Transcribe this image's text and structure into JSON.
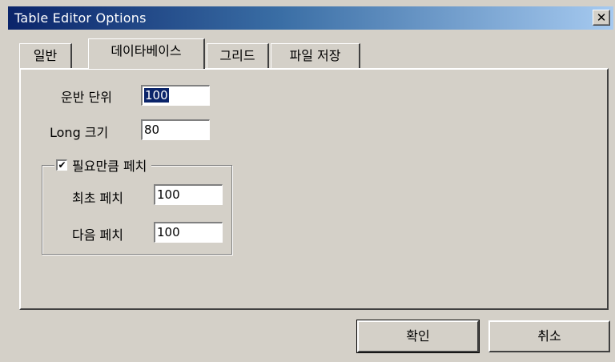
{
  "window": {
    "title": "Table Editor Options",
    "close_glyph": "✕"
  },
  "tabs": [
    {
      "label": "일반",
      "active": false
    },
    {
      "label": "데이타베이스",
      "active": true
    },
    {
      "label": "그리드",
      "active": false
    },
    {
      "label": "파일 저장",
      "active": false
    }
  ],
  "fields": {
    "transfer_unit": {
      "label": "운반 단위",
      "value": "100"
    },
    "long_size": {
      "label": "Long 크기",
      "value": "80"
    }
  },
  "fetch_group": {
    "checkbox_label": "필요만큼 페치",
    "checked": true,
    "check_glyph": "✔",
    "first_fetch": {
      "label": "최초 페치",
      "value": "100"
    },
    "next_fetch": {
      "label": "다음 페치",
      "value": "100"
    }
  },
  "buttons": {
    "ok": "확인",
    "cancel": "취소"
  }
}
